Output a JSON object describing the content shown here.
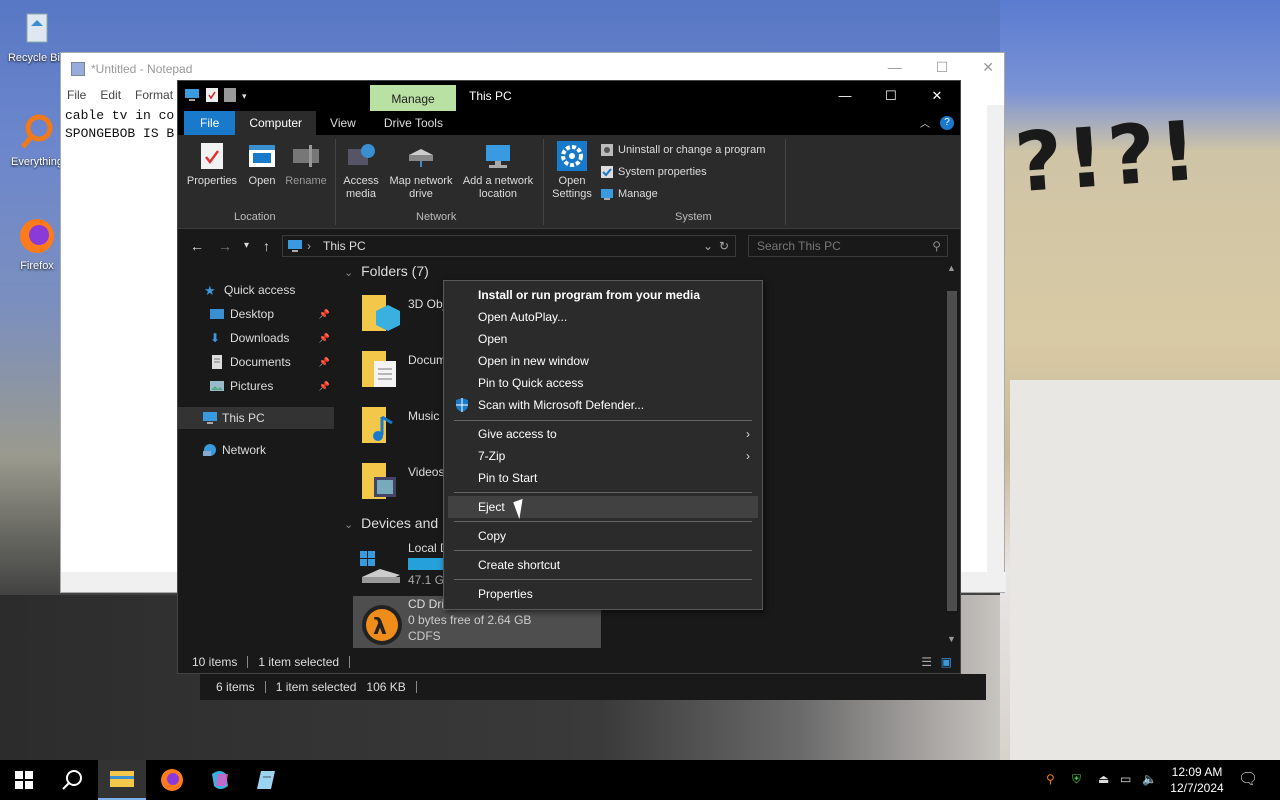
{
  "desktop": {
    "icons": [
      {
        "label": "Recycle Bin"
      },
      {
        "label": "Everything"
      },
      {
        "label": "Firefox"
      }
    ],
    "doodle_text": "?!?!"
  },
  "notepad": {
    "title": "*Untitled - Notepad",
    "menu": [
      "File",
      "Edit",
      "Format"
    ],
    "lines": [
      "cable tv in co",
      "SPONGEBOB IS B"
    ]
  },
  "explorer": {
    "manage_tab": "Manage",
    "window_title": "This PC",
    "tabs": [
      "File",
      "Computer",
      "View",
      "Drive Tools"
    ],
    "ribbon": {
      "location": {
        "group": "Location",
        "buttons": [
          "Properties",
          "Open",
          "Rename"
        ]
      },
      "network": {
        "group": "Network",
        "buttons": [
          "Access media",
          "Map network drive",
          "Add a network location"
        ]
      },
      "system": {
        "group": "System",
        "open_settings": "Open Settings",
        "items": [
          "Uninstall or change a program",
          "System properties",
          "Manage"
        ]
      }
    },
    "address": "This PC",
    "search_placeholder": "Search This PC",
    "nav": {
      "quick_access": "Quick access",
      "items": [
        "Desktop",
        "Downloads",
        "Documents",
        "Pictures"
      ],
      "this_pc": "This PC",
      "network": "Network"
    },
    "folders_header": "Folders (7)",
    "folders": [
      "3D Obj",
      "Docum",
      "Music",
      "Videos"
    ],
    "devices_header": "Devices and",
    "devices": [
      {
        "name": "Local D",
        "free": "47.1 GB"
      },
      {
        "name": "CD Dri",
        "free": "0 bytes free of 2.64 GB",
        "fs": "CDFS"
      }
    ],
    "status": {
      "items": "10 items",
      "selected": "1 item selected"
    }
  },
  "behind_status": {
    "items": "6 items",
    "selected": "1 item selected",
    "size": "106 KB"
  },
  "context_menu": {
    "groups": [
      [
        "Install or run program from your media",
        "Open AutoPlay...",
        "Open",
        "Open in new window",
        "Pin to Quick access",
        "Scan with Microsoft Defender..."
      ],
      [
        "Give access to",
        "7-Zip",
        "Pin to Start"
      ],
      [
        "Eject"
      ],
      [
        "Copy"
      ],
      [
        "Create shortcut"
      ],
      [
        "Properties"
      ]
    ]
  },
  "taskbar": {
    "time": "12:09 AM",
    "date": "12/7/2024"
  }
}
